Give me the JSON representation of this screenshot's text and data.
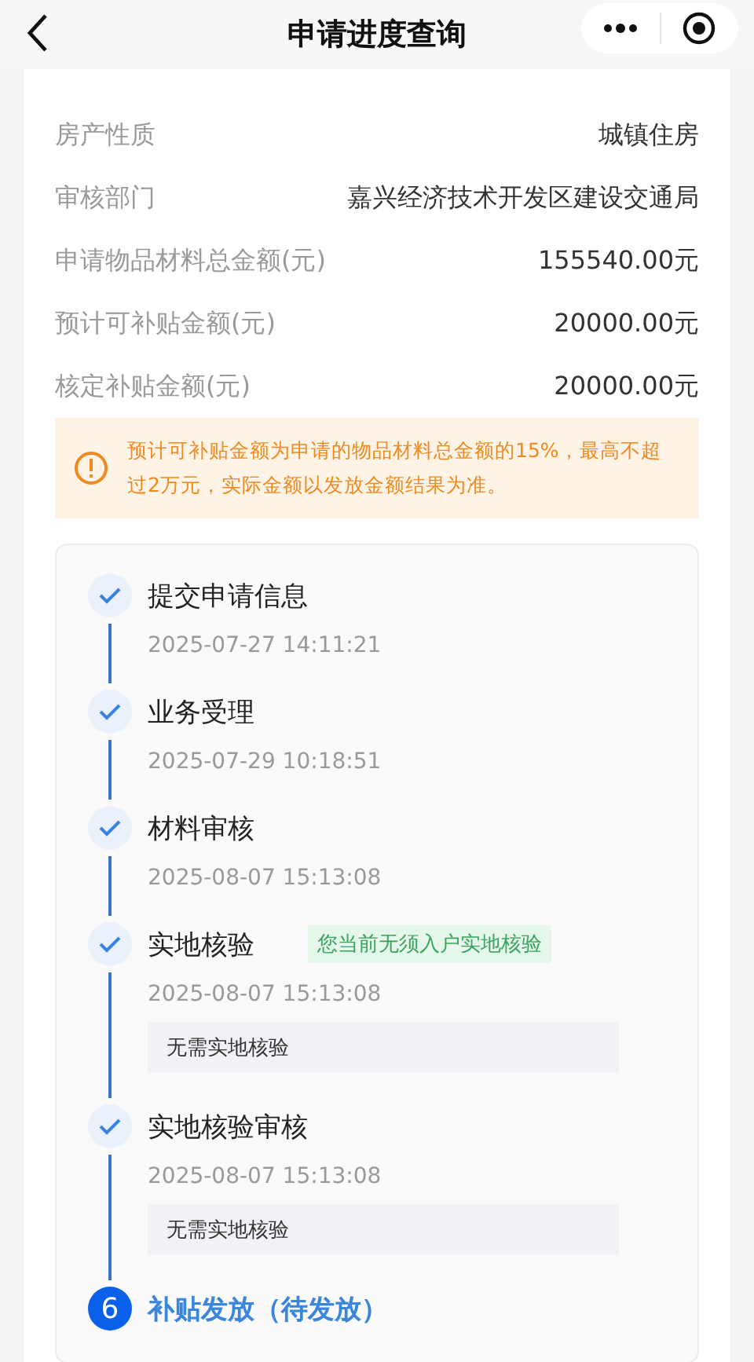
{
  "header": {
    "title": "申请进度查询"
  },
  "details": [
    {
      "label": "房产性质",
      "value": "城镇住房"
    },
    {
      "label": "审核部门",
      "value": "嘉兴经济技术开发区建设交通局"
    },
    {
      "label": "申请物品材料总金额(元)",
      "value": "155540.00元"
    },
    {
      "label": "预计可补贴金额(元)",
      "value": "20000.00元"
    },
    {
      "label": "核定补贴金额(元)",
      "value": "20000.00元"
    }
  ],
  "notice": "预计可补贴金额为申请的物品材料总金额的15%，最高不超过2万元，实际金额以发放金额结果为准。",
  "steps": [
    {
      "done": true,
      "title": "提交申请信息",
      "time": "2025-07-27 14:11:21"
    },
    {
      "done": true,
      "title": "业务受理",
      "time": "2025-07-29 10:18:51"
    },
    {
      "done": true,
      "title": "材料审核",
      "time": "2025-08-07 15:13:08"
    },
    {
      "done": true,
      "title": "实地核验",
      "tag": "您当前无须入户实地核验",
      "time": "2025-08-07 15:13:08",
      "note": "无需实地核验"
    },
    {
      "done": true,
      "title": "实地核验审核",
      "time": "2025-08-07 15:13:08",
      "note": "无需实地核验"
    },
    {
      "done": false,
      "number": "6",
      "title": "补贴发放（待发放）"
    }
  ]
}
